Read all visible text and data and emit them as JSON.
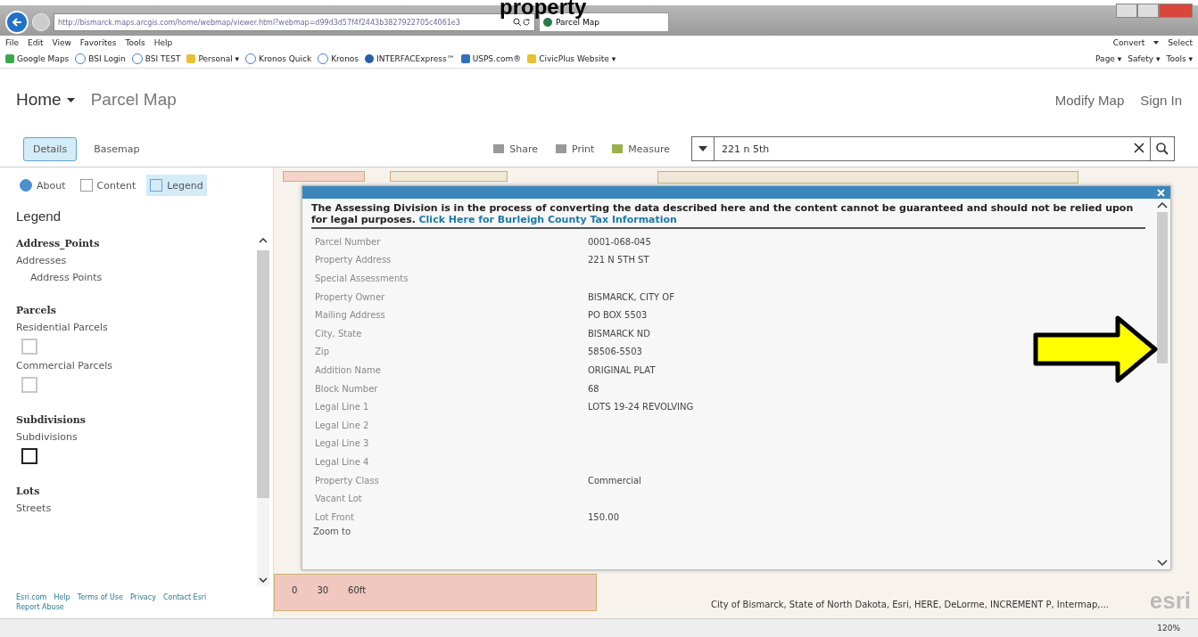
{
  "caption": "property",
  "browser": {
    "url": "http://bismarck.maps.arcgis.com/home/webmap/viewer.html?webmap=d99d3d57f4f2443b3827922705c4061e3",
    "tab_title": "Parcel Map",
    "menu": [
      "File",
      "Edit",
      "View",
      "Favorites",
      "Tools",
      "Help"
    ],
    "favorites": [
      {
        "label": "Google Maps",
        "kind": "maps"
      },
      {
        "label": "BSI Login",
        "kind": "page"
      },
      {
        "label": "BSI TEST",
        "kind": "page"
      },
      {
        "label": "Personal ▾",
        "kind": "folder"
      },
      {
        "label": "Kronos Quick",
        "kind": "page"
      },
      {
        "label": "Kronos",
        "kind": "page"
      },
      {
        "label": "INTERFACExpress™",
        "kind": "globe"
      },
      {
        "label": "USPS.com®",
        "kind": "usps"
      },
      {
        "label": "CivicPlus Website ▾",
        "kind": "folder"
      }
    ],
    "command_bar": [
      "Page ▾",
      "Safety ▾",
      "Tools ▾"
    ],
    "convert": "Convert",
    "select": "Select",
    "zoom": "120%"
  },
  "app": {
    "home": "Home",
    "title": "Parcel Map",
    "modify": "Modify Map",
    "sign_in": "Sign In"
  },
  "toolbar": {
    "tabs": [
      {
        "label": "Details",
        "selected": true
      },
      {
        "label": "Basemap",
        "selected": false
      }
    ],
    "actions": [
      {
        "label": "Share",
        "kind": "share"
      },
      {
        "label": "Print",
        "kind": "print"
      },
      {
        "label": "Measure",
        "kind": "measure"
      }
    ],
    "search": {
      "value": "221 n 5th"
    }
  },
  "side_tabs": [
    {
      "label": "About",
      "kind": "about",
      "selected": false
    },
    {
      "label": "Content",
      "kind": "content",
      "selected": false
    },
    {
      "label": "Legend",
      "kind": "legend",
      "selected": true
    }
  ],
  "legend": {
    "heading": "Legend",
    "items": [
      {
        "kind": "group",
        "label": "Address_Points"
      },
      {
        "kind": "layer",
        "label": "Addresses"
      },
      {
        "kind": "sublayer",
        "label": "Address Points"
      },
      {
        "kind": "group",
        "label": "Parcels"
      },
      {
        "kind": "layer",
        "label": "Residential Parcels"
      },
      {
        "kind": "swatch",
        "color": "#c8c8c8"
      },
      {
        "kind": "layer",
        "label": "Commercial Parcels"
      },
      {
        "kind": "swatch",
        "color": "#c8c8c8"
      },
      {
        "kind": "group",
        "label": "Subdivisions"
      },
      {
        "kind": "layer",
        "label": "Subdivisions"
      },
      {
        "kind": "swatch",
        "color": "#222222"
      },
      {
        "kind": "group",
        "label": "Lots"
      },
      {
        "kind": "layer",
        "label": "Streets"
      }
    ]
  },
  "footer_links": [
    "Esri.com",
    "Help",
    "Terms of Use",
    "Privacy",
    "Contact Esri",
    "Report Abuse"
  ],
  "map": {
    "scale": [
      "0",
      "30",
      "60ft"
    ],
    "attribution": "City of Bismarck, State of North Dakota, Esri, HERE, DeLorme, INCREMENT P, Intermap,...",
    "logo": "esri"
  },
  "popup": {
    "notice": "**The Assessing Division is in the process of converting the data described here and the content cannot be guaranteed and should not be relied upon for legal purposes.**",
    "link": "Click Here for Burleigh County Tax Information",
    "rows": [
      {
        "label": "Parcel Number",
        "value": "0001-068-045"
      },
      {
        "label": "Property Address",
        "value": "221 N 5TH ST"
      },
      {
        "label": "Special Assessments"
      },
      {
        "label": "Property Owner",
        "value": "BISMARCK, CITY OF"
      },
      {
        "label": "Mailing Address",
        "value": "PO BOX 5503"
      },
      {
        "label": "City, State",
        "value": "BISMARCK ND"
      },
      {
        "label": "Zip",
        "value": "58506-5503"
      },
      {
        "label": "Addition Name",
        "value": "ORIGINAL PLAT"
      },
      {
        "label": "Block Number",
        "value": "68"
      },
      {
        "label": "Legal Line 1",
        "value": "LOTS 19-24 REVOLVING"
      },
      {
        "label": "Legal Line 2"
      },
      {
        "label": "Legal Line 3"
      },
      {
        "label": "Legal Line 4"
      },
      {
        "label": "Property Class",
        "value": "Commercial"
      },
      {
        "label": "Vacant Lot"
      },
      {
        "label": "Lot Front",
        "value": "150.00"
      }
    ],
    "zoom_link": "Zoom to"
  }
}
